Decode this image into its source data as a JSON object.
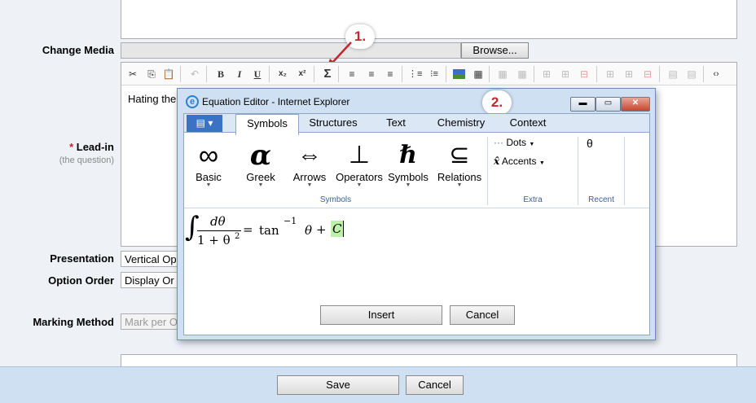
{
  "form": {
    "change_media_label": "Change Media",
    "browse_label": "Browse...",
    "lead_in_star": "*",
    "lead_in_label": "Lead-in",
    "lead_in_sub": "(the question)",
    "editor_text": "Hating the",
    "presentation_label": "Presentation",
    "presentation_value": "Vertical Op",
    "option_order_label": "Option Order",
    "option_order_value": "Display Or",
    "marking_method_label": "Marking Method",
    "marking_method_value": "Mark per O",
    "save_label": "Save",
    "cancel_label": "Cancel"
  },
  "toolbar": {
    "icons": [
      "cut-icon",
      "copy-icon",
      "paste-icon",
      "undo-icon",
      "bold-icon",
      "italic-icon",
      "underline-icon",
      "subscript-icon",
      "superscript-icon",
      "sigma-icon",
      "align-left-icon",
      "align-center-icon",
      "align-right-icon",
      "numbered-list-icon",
      "bullet-list-icon",
      "image-icon",
      "edit-table-icon",
      "table-icon",
      "table-cells-icon",
      "insert-row-icon",
      "insert-col-icon",
      "delete-row-icon",
      "merge-icon",
      "split-icon",
      "delete-col-icon",
      "table-props-icon",
      "cell-props-icon",
      "source-code-icon"
    ]
  },
  "annotations": {
    "step1": "1.",
    "step2": "2."
  },
  "dialog": {
    "title": "Equation Editor - Internet Explorer",
    "menu_glyph": "▤ ▾",
    "tabs": [
      "Symbols",
      "Structures",
      "Text",
      "Chemistry",
      "Context"
    ],
    "active_tab": "Symbols",
    "symbols": [
      {
        "glyph": "∞",
        "label": "Basic"
      },
      {
        "glyph": "α",
        "label": "Greek"
      },
      {
        "glyph": "⇔",
        "label": "Arrows"
      },
      {
        "glyph": "⊥",
        "label": "Operators"
      },
      {
        "glyph": "ℏ",
        "label": "Symbols"
      },
      {
        "glyph": "⊆",
        "label": "Relations"
      }
    ],
    "symbols_group_label": "Symbols",
    "dots_label": "Dots",
    "accents_label": "Accents",
    "extra_group_label": "Extra",
    "recent_symbol": "θ",
    "recent_group_label": "Recent",
    "equation": {
      "integral": "∫",
      "numerator": "dθ",
      "denominator": "1 + θ",
      "den_exp": "2",
      "equals": "=",
      "func": "tan",
      "exp": "−1",
      "theta": "θ",
      "plus": "+",
      "const": "C"
    },
    "insert_label": "Insert",
    "cancel_label": "Cancel"
  },
  "colors": {
    "accent_red": "#c4262e",
    "dialog_blue": "#cfe0f3",
    "tab_blue": "#3a72c4"
  }
}
